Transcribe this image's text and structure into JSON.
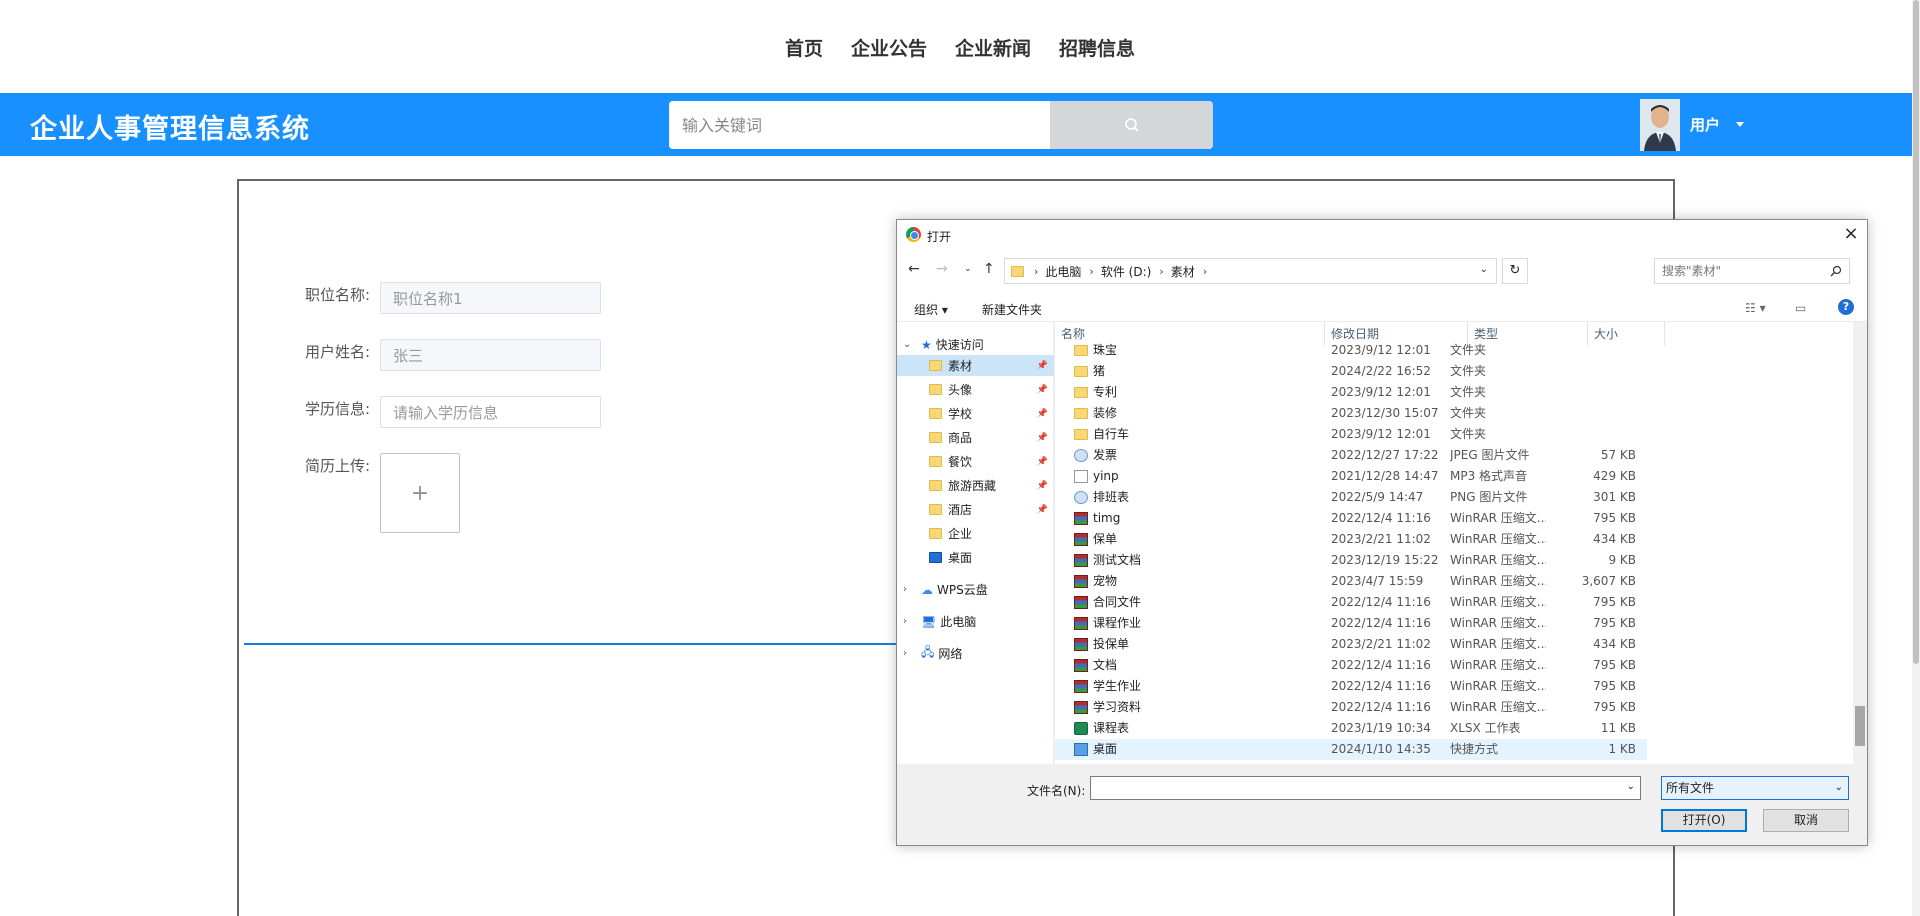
{
  "topnav": {
    "items": [
      "首页",
      "企业公告",
      "企业新闻",
      "招聘信息"
    ]
  },
  "header": {
    "brand": "企业人事管理信息系统",
    "search_placeholder": "输入关键词",
    "user_label": "用户"
  },
  "form": {
    "position_label": "职位名称:",
    "position_value": "职位名称1",
    "username_label": "用户姓名:",
    "username_value": "张三",
    "education_label": "学历信息:",
    "education_placeholder": "请输入学历信息",
    "resume_label": "简历上传:",
    "upload_plus": "+"
  },
  "dialog": {
    "title": "打开",
    "close": "×",
    "breadcrumb": [
      "此电脑",
      "软件 (D:)",
      "素材"
    ],
    "search_placeholder": "搜索\"素材\"",
    "toolbar": {
      "organize": "组织 ▾",
      "new_folder": "新建文件夹",
      "help": "?"
    },
    "tree": {
      "quick_access": "快速访问",
      "items": [
        "素材",
        "头像",
        "学校",
        "商品",
        "餐饮",
        "旅游西藏",
        "酒店",
        "企业",
        "桌面"
      ],
      "wps": "WPS云盘",
      "this_pc": "此电脑",
      "network": "网络"
    },
    "columns": {
      "name": "名称",
      "date": "修改日期",
      "type": "类型",
      "size": "大小"
    },
    "files": [
      {
        "name": "珠宝",
        "date": "2023/9/12 12:01",
        "type": "文件夹",
        "size": "",
        "icon": "folder"
      },
      {
        "name": "猪",
        "date": "2024/2/22 16:52",
        "type": "文件夹",
        "size": "",
        "icon": "folder"
      },
      {
        "name": "专利",
        "date": "2023/9/12 12:01",
        "type": "文件夹",
        "size": "",
        "icon": "folder"
      },
      {
        "name": "装修",
        "date": "2023/12/30 15:07",
        "type": "文件夹",
        "size": "",
        "icon": "folder"
      },
      {
        "name": "自行车",
        "date": "2023/9/12 12:01",
        "type": "文件夹",
        "size": "",
        "icon": "folder"
      },
      {
        "name": "发票",
        "date": "2022/12/27 17:22",
        "type": "JPEG 图片文件",
        "size": "57 KB",
        "icon": "img"
      },
      {
        "name": "yinp",
        "date": "2021/12/28 14:47",
        "type": "MP3 格式声音",
        "size": "429 KB",
        "icon": "mp3"
      },
      {
        "name": "排班表",
        "date": "2022/5/9 14:47",
        "type": "PNG 图片文件",
        "size": "301 KB",
        "icon": "img"
      },
      {
        "name": "timg",
        "date": "2022/12/4 11:16",
        "type": "WinRAR 压缩文...",
        "size": "795 KB",
        "icon": "rar"
      },
      {
        "name": "保单",
        "date": "2023/2/21 11:02",
        "type": "WinRAR 压缩文...",
        "size": "434 KB",
        "icon": "rar"
      },
      {
        "name": "测试文档",
        "date": "2023/12/19 15:22",
        "type": "WinRAR 压缩文...",
        "size": "9 KB",
        "icon": "rar"
      },
      {
        "name": "宠物",
        "date": "2023/4/7 15:59",
        "type": "WinRAR 压缩文...",
        "size": "3,607 KB",
        "icon": "rar"
      },
      {
        "name": "合同文件",
        "date": "2022/12/4 11:16",
        "type": "WinRAR 压缩文...",
        "size": "795 KB",
        "icon": "rar"
      },
      {
        "name": "课程作业",
        "date": "2022/12/4 11:16",
        "type": "WinRAR 压缩文...",
        "size": "795 KB",
        "icon": "rar"
      },
      {
        "name": "投保单",
        "date": "2023/2/21 11:02",
        "type": "WinRAR 压缩文...",
        "size": "434 KB",
        "icon": "rar"
      },
      {
        "name": "文档",
        "date": "2022/12/4 11:16",
        "type": "WinRAR 压缩文...",
        "size": "795 KB",
        "icon": "rar"
      },
      {
        "name": "学生作业",
        "date": "2022/12/4 11:16",
        "type": "WinRAR 压缩文...",
        "size": "795 KB",
        "icon": "rar"
      },
      {
        "name": "学习资料",
        "date": "2022/12/4 11:16",
        "type": "WinRAR 压缩文...",
        "size": "795 KB",
        "icon": "rar"
      },
      {
        "name": "课程表",
        "date": "2023/1/19 10:34",
        "type": "XLSX 工作表",
        "size": "11 KB",
        "icon": "xlsx"
      },
      {
        "name": "桌面",
        "date": "2024/1/10 14:35",
        "type": "快捷方式",
        "size": "1 KB",
        "icon": "lnk"
      }
    ],
    "filename_label": "文件名(N):",
    "filetype_value": "所有文件",
    "open_button": "打开(O)",
    "cancel_button": "取消"
  }
}
